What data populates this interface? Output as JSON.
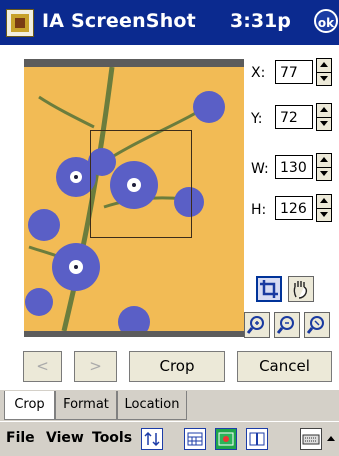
{
  "titlebar": {
    "app_title": "IA ScreenShot",
    "time": "3:31p",
    "ok_label": "ok"
  },
  "fields": {
    "x": {
      "label": "X:",
      "value": "77"
    },
    "y": {
      "label": "Y:",
      "value": "72"
    },
    "w": {
      "label": "W:",
      "value": "130"
    },
    "h": {
      "label": "H:",
      "value": "126"
    }
  },
  "tools": {
    "crop_tool_icon": "crop-icon",
    "pan_tool_icon": "hand-icon",
    "zoom_icons": [
      "zoom-in-icon",
      "zoom-out-icon",
      "zoom-fit-icon"
    ]
  },
  "buttons": {
    "prev": "<",
    "next": ">",
    "crop": "Crop",
    "cancel": "Cancel"
  },
  "tabs": [
    "Crop",
    "Format",
    "Location"
  ],
  "menubar": {
    "file": "File",
    "view": "View",
    "tools": "Tools"
  },
  "colors": {
    "titlebar": "#0b2a8f",
    "accent": "#1d3da8"
  }
}
